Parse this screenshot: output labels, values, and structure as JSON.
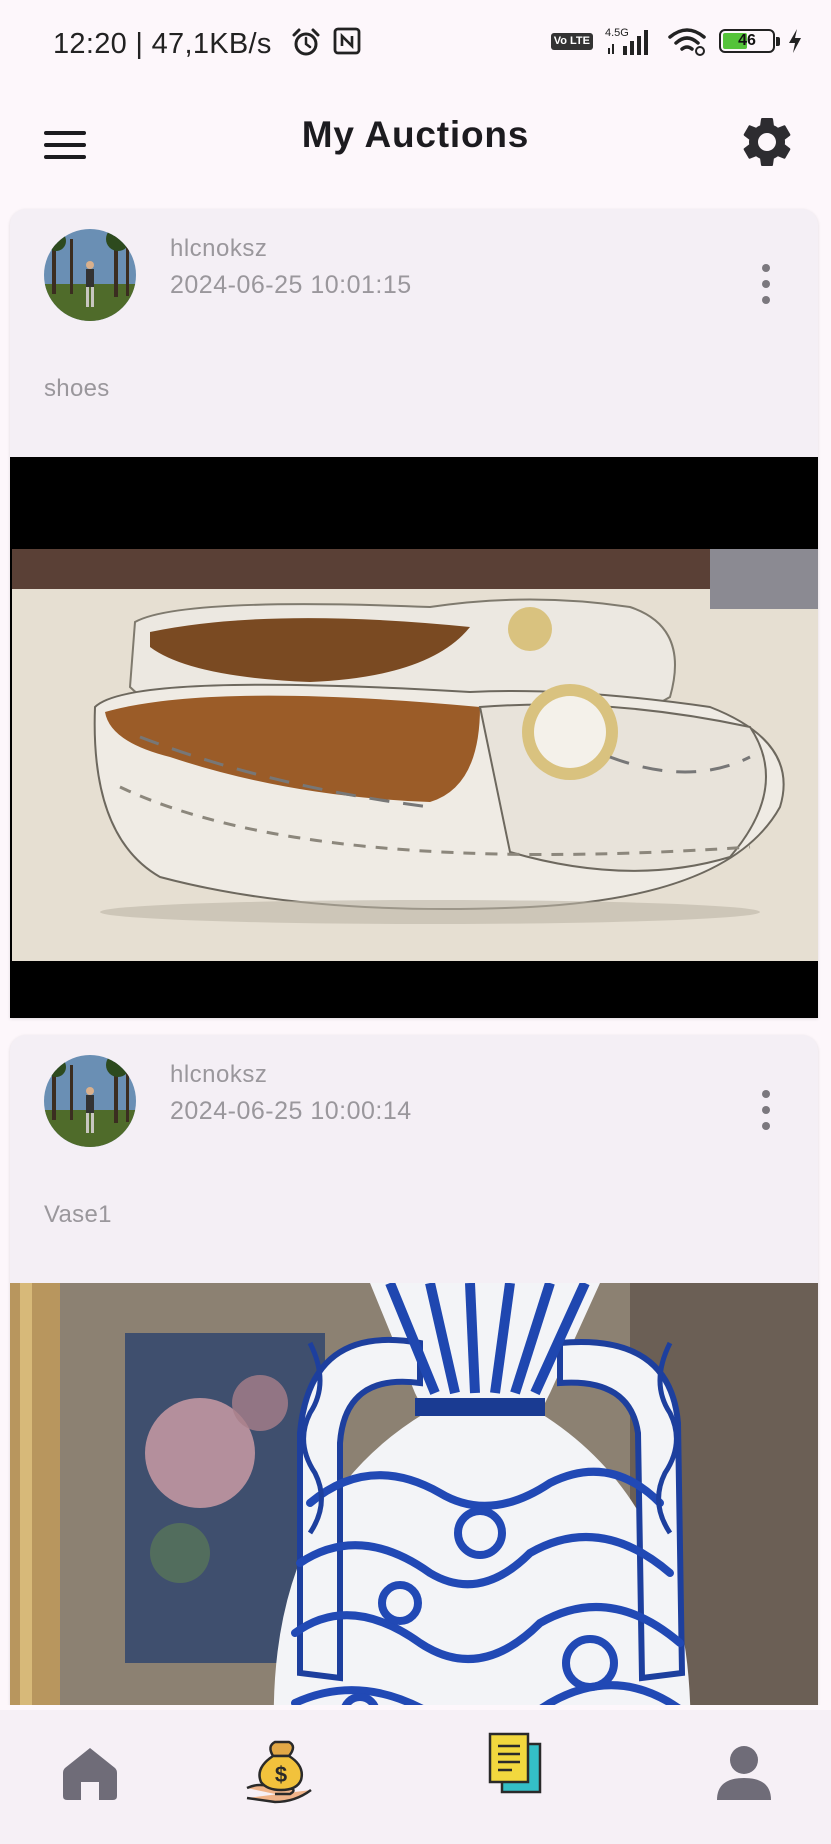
{
  "status_bar": {
    "time_text": "12:20 | 47,1KB/s",
    "network": "4.5G",
    "volte": "Vo LTE",
    "battery_percent": "46",
    "icons": [
      "alarm-icon",
      "nfc-icon",
      "signal-icon",
      "wifi-icon",
      "battery-icon",
      "charging-icon"
    ]
  },
  "app_bar": {
    "title": "My Auctions",
    "left_icon": "menu-icon",
    "right_icon": "settings-icon"
  },
  "auctions": [
    {
      "author": "hlcnoksz",
      "date": "2024-06-25 10:01:15",
      "title": "shoes",
      "image": "loafer-shoes-photo",
      "menu_icon": "more-vert-icon"
    },
    {
      "author": "hlcnoksz",
      "date": "2024-06-25 10:00:14",
      "title": "Vase1",
      "image": "blue-white-vase-photo",
      "menu_icon": "more-vert-icon"
    }
  ],
  "bottom_nav": {
    "items": [
      "home-icon",
      "money-bag-icon",
      "auctions-docs-icon",
      "profile-icon"
    ],
    "active": "auctions-docs-icon"
  },
  "colors": {
    "background": "#fdf7fb",
    "card": "#f4eff5",
    "muted_text": "#9a979c",
    "nav_icon": "#6f6c78",
    "battery_fill": "#55c33a"
  }
}
